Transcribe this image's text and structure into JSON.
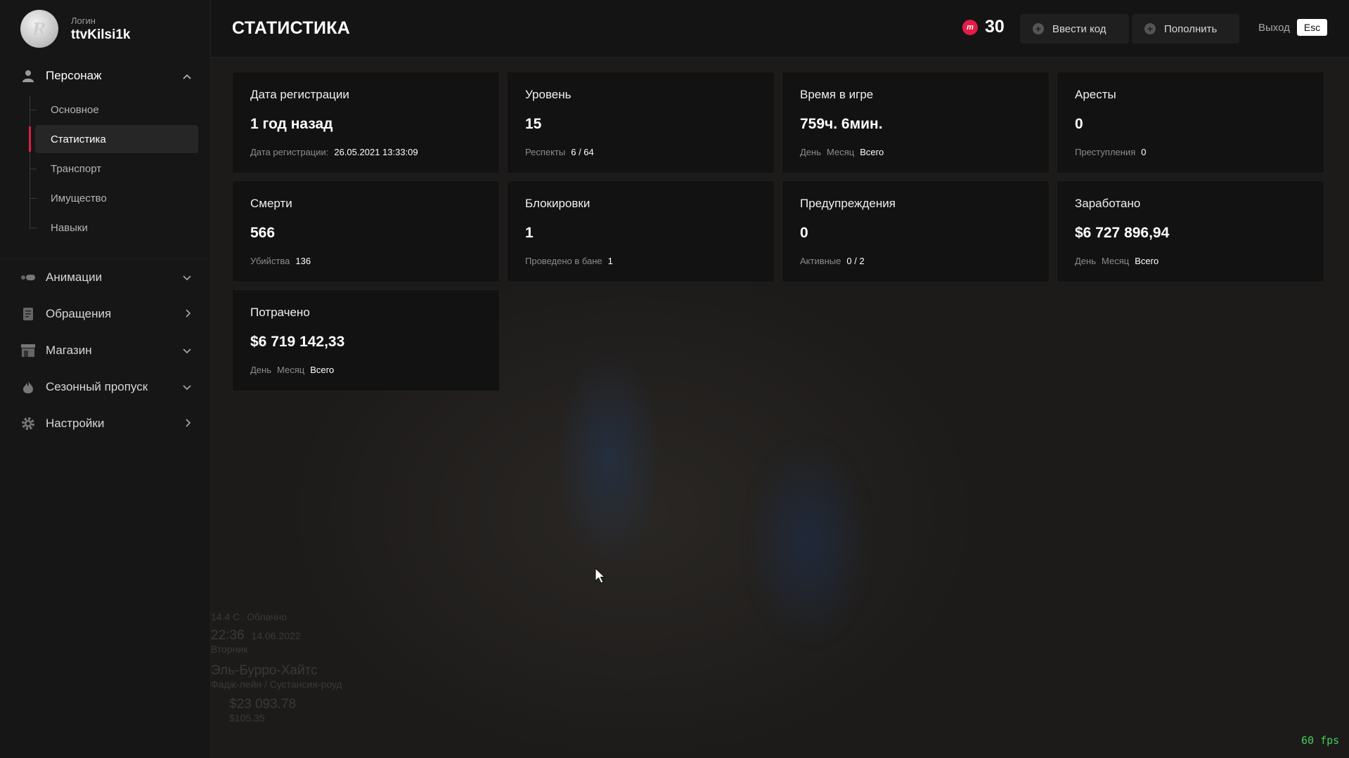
{
  "profile": {
    "label": "Логин",
    "name": "ttvKilsi1k",
    "avatar_letter": "R"
  },
  "sidebar": {
    "character": {
      "label": "Персонаж",
      "icon": "user-icon"
    },
    "sub_items": [
      {
        "label": "Основное",
        "active": false
      },
      {
        "label": "Статистика",
        "active": true
      },
      {
        "label": "Транспорт",
        "active": false
      },
      {
        "label": "Имущество",
        "active": false
      },
      {
        "label": "Навыки",
        "active": false
      }
    ],
    "sections": [
      {
        "label": "Анимации",
        "icon": "animation-icon",
        "chevron": "down"
      },
      {
        "label": "Обращения",
        "icon": "document-icon",
        "chevron": "right"
      },
      {
        "label": "Магазин",
        "icon": "store-icon",
        "chevron": "down"
      },
      {
        "label": "Сезонный пропуск",
        "icon": "flame-icon",
        "chevron": "down"
      },
      {
        "label": "Настройки",
        "icon": "gear-icon",
        "chevron": "right"
      }
    ]
  },
  "header": {
    "title": "СТАТИСТИКА",
    "coin_symbol": "m",
    "balance": "30",
    "enter_code_label": "Ввести код",
    "top_up_label": "Пополнить",
    "exit_label": "Выход",
    "esc_key": "Esc"
  },
  "cards": [
    {
      "title": "Дата регистрации",
      "value": "1 год назад",
      "sub": [
        [
          "Дата регистрации:",
          false
        ],
        [
          "26.05.2021 13:33:09",
          true
        ]
      ]
    },
    {
      "title": "Уровень",
      "value": "15",
      "sub": [
        [
          "Респекты",
          false
        ],
        [
          "6 / 64",
          true
        ]
      ]
    },
    {
      "title": "Время в игре",
      "value": "759ч. 6мин.",
      "sub": [
        [
          "День",
          false
        ],
        [
          "Месяц",
          false
        ],
        [
          "Всего",
          true
        ]
      ]
    },
    {
      "title": "Аресты",
      "value": "0",
      "sub": [
        [
          "Преступления",
          false
        ],
        [
          "0",
          true
        ]
      ]
    },
    {
      "title": "Смерти",
      "value": "566",
      "sub": [
        [
          "Убийства",
          false
        ],
        [
          "136",
          true
        ]
      ]
    },
    {
      "title": "Блокировки",
      "value": "1",
      "sub": [
        [
          "Проведено в бане",
          false
        ],
        [
          "1",
          true
        ]
      ]
    },
    {
      "title": "Предупреждения",
      "value": "0",
      "sub": [
        [
          "Активные",
          false
        ],
        [
          "0 / 2",
          true
        ]
      ]
    },
    {
      "title": "Заработано",
      "value": "$6 727 896,94",
      "sub": [
        [
          "День",
          false
        ],
        [
          "Месяц",
          false
        ],
        [
          "Всего",
          true
        ]
      ]
    },
    {
      "title": "Потрачено",
      "value": "$6 719 142,33",
      "sub": [
        [
          "День",
          false
        ],
        [
          "Месяц",
          false
        ],
        [
          "Всего",
          true
        ]
      ]
    }
  ],
  "hud": {
    "weather_temp": "14.4 C",
    "weather_desc": "Облачно",
    "time": "22:36",
    "date": "14.06.2022",
    "weekday": "Вторник",
    "location": "Эль-Бурро-Хайтс",
    "street": "Фадж-лейн / Сустансия-роуд",
    "cash": "$23 093.78",
    "bank": "$105.35"
  },
  "fps": "60 fps"
}
